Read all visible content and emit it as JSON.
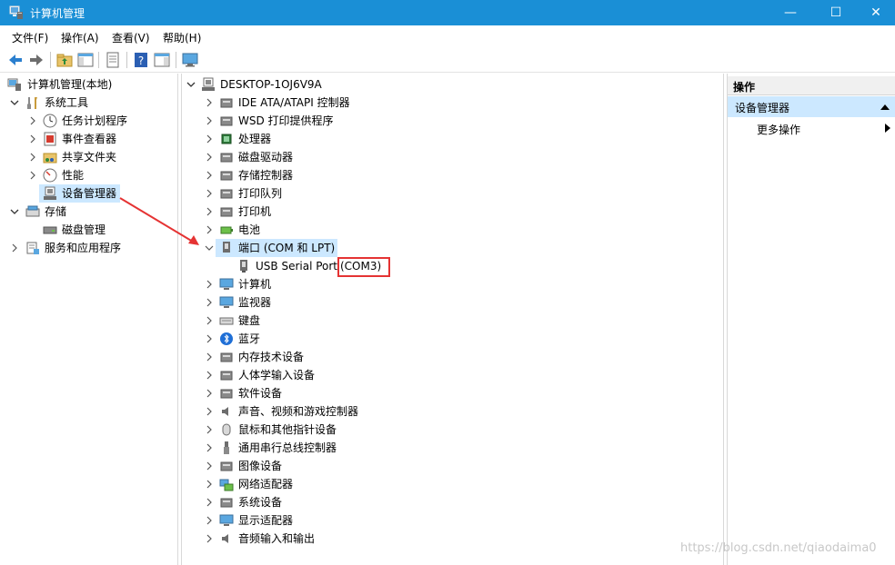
{
  "window": {
    "title": "计算机管理",
    "controls": {
      "minimize": "—",
      "maximize": "☐",
      "close": "✕"
    },
    "accent": "#1a8fd6"
  },
  "menubar": {
    "items": [
      "文件(F)",
      "操作(A)",
      "查看(V)",
      "帮助(H)"
    ]
  },
  "toolbar": {
    "icons": [
      "back-icon",
      "forward-icon",
      "up-folder-icon",
      "show-hide-tree-icon",
      "properties-icon",
      "help-icon",
      "action-pane-icon",
      "computer-monitor-icon"
    ]
  },
  "left_tree": {
    "root": "计算机管理(本地)",
    "items": [
      {
        "label": "系统工具",
        "expanded": true,
        "icon": "tools-icon"
      },
      {
        "label": "任务计划程序",
        "icon": "clock-icon"
      },
      {
        "label": "事件查看器",
        "icon": "event-viewer-icon"
      },
      {
        "label": "共享文件夹",
        "icon": "shared-folder-icon"
      },
      {
        "label": "性能",
        "icon": "performance-icon"
      },
      {
        "label": "设备管理器",
        "icon": "device-manager-icon",
        "selected": true
      },
      {
        "label": "存储",
        "expanded": true,
        "icon": "storage-icon"
      },
      {
        "label": "磁盘管理",
        "icon": "disk-management-icon"
      },
      {
        "label": "服务和应用程序",
        "icon": "services-icon"
      }
    ]
  },
  "device_tree": {
    "root": "DESKTOP-1OJ6V9A",
    "categories": [
      "IDE ATA/ATAPI 控制器",
      "WSD 打印提供程序",
      "处理器",
      "磁盘驱动器",
      "存储控制器",
      "打印队列",
      "打印机",
      "电池",
      "端口 (COM 和 LPT)",
      "计算机",
      "监视器",
      "键盘",
      "蓝牙",
      "内存技术设备",
      "人体学输入设备",
      "软件设备",
      "声音、视频和游戏控制器",
      "鼠标和其他指针设备",
      "通用串行总线控制器",
      "图像设备",
      "网络适配器",
      "系统设备",
      "显示适配器",
      "音频输入和输出"
    ],
    "port_child": {
      "name": "USB Serial Port ",
      "port": "(COM3)"
    }
  },
  "actions_pane": {
    "header": "操作",
    "section": "设备管理器",
    "more": "更多操作"
  },
  "annotation": {
    "box_color": "#e53333",
    "arrow_color": "#e53333"
  },
  "watermark": "https://blog.csdn.net/qiaodaima0"
}
